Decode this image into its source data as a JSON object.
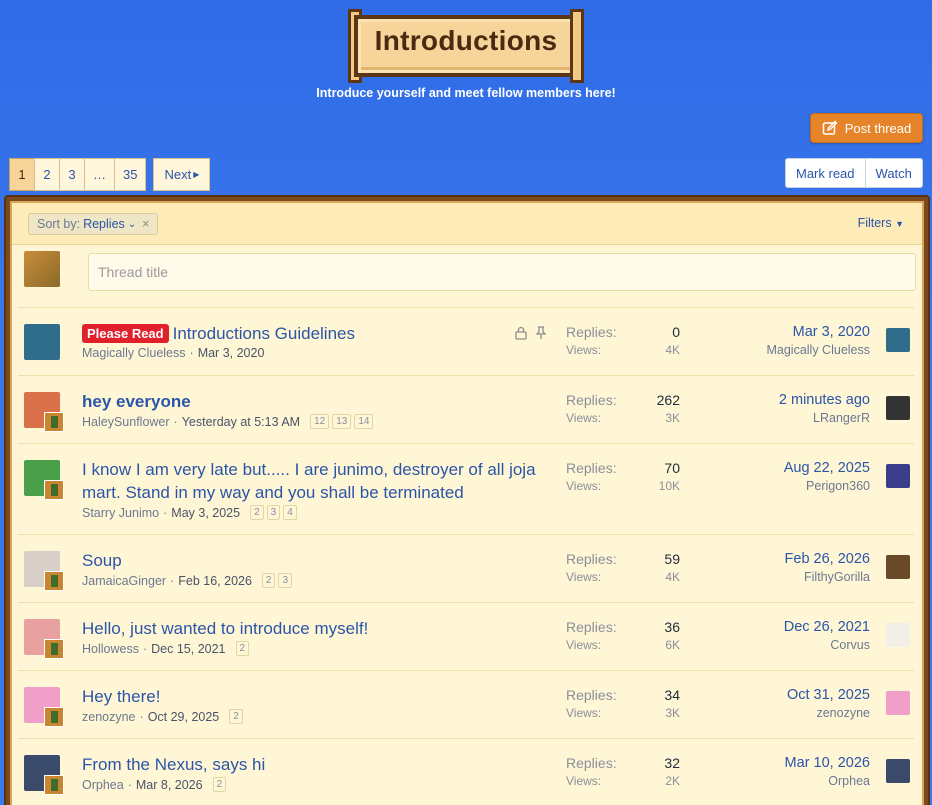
{
  "banner": {
    "title": "Introductions",
    "subtitle": "Introduce yourself and meet fellow members here!"
  },
  "post_thread": {
    "label": "Post thread",
    "icon": "edit-icon"
  },
  "pagination": {
    "pages": [
      "1",
      "2",
      "3",
      "…",
      "35"
    ],
    "current": "1",
    "next_label": "Next"
  },
  "actions": {
    "mark_read": "Mark read",
    "watch": "Watch"
  },
  "filterbar": {
    "sort_label": "Sort by:",
    "sort_value": "Replies",
    "clear": "×",
    "filters_label": "Filters"
  },
  "new_thread": {
    "placeholder": "Thread title"
  },
  "stat_labels": {
    "replies": "Replies:",
    "views": "Views:"
  },
  "threads": [
    {
      "prefix": "Please Read",
      "title": "Introductions Guidelines",
      "author": "Magically Clueless",
      "date": "Mar 3, 2020",
      "pages": [],
      "replies": "0",
      "views": "4K",
      "last_date": "Mar 3, 2020",
      "last_user": "Magically Clueless",
      "locked": true,
      "sticky": true,
      "colors": {
        "avatar": "#2f6d8a",
        "last_avatar": "#2f6d8a"
      }
    },
    {
      "prefix": "",
      "title": "hey everyone",
      "author": "HaleySunflower",
      "date": "Yesterday at 5:13 AM",
      "pages": [
        "12",
        "13",
        "14"
      ],
      "replies": "262",
      "views": "3K",
      "last_date": "2 minutes ago",
      "last_user": "LRangerR",
      "unread": true,
      "colors": {
        "avatar": "#d9704a",
        "last_avatar": "#333333"
      }
    },
    {
      "prefix": "",
      "title": "I know I am very late but..... I are junimo, destroyer of all joja mart. Stand in my way and you shall be terminated",
      "author": "Starry Junimo",
      "date": "May 3, 2025",
      "pages": [
        "2",
        "3",
        "4"
      ],
      "replies": "70",
      "views": "10K",
      "last_date": "Aug 22, 2025",
      "last_user": "Perigon360",
      "colors": {
        "avatar": "#4aa04a",
        "last_avatar": "#3a3e8a"
      }
    },
    {
      "prefix": "",
      "title": "Soup",
      "author": "JamaicaGinger",
      "date": "Feb 16, 2026",
      "pages": [
        "2",
        "3"
      ],
      "replies": "59",
      "views": "4K",
      "last_date": "Feb 26, 2026",
      "last_user": "FilthyGorilla",
      "colors": {
        "avatar": "#d8d0c8",
        "last_avatar": "#6b4a2a"
      }
    },
    {
      "prefix": "",
      "title": "Hello, just wanted to introduce myself!",
      "author": "Hollowess",
      "date": "Dec 15, 2021",
      "pages": [
        "2"
      ],
      "replies": "36",
      "views": "6K",
      "last_date": "Dec 26, 2021",
      "last_user": "Corvus",
      "colors": {
        "avatar": "#e8a0a0",
        "last_avatar": "#f2efe6"
      }
    },
    {
      "prefix": "",
      "title": "Hey there!",
      "author": "zenozyne",
      "date": "Oct 29, 2025",
      "pages": [
        "2"
      ],
      "replies": "34",
      "views": "3K",
      "last_date": "Oct 31, 2025",
      "last_user": "zenozyne",
      "colors": {
        "avatar": "#f0a0c8",
        "last_avatar": "#f0a0c8"
      }
    },
    {
      "prefix": "",
      "title": "From the Nexus, says hi",
      "author": "Orphea",
      "date": "Mar 8, 2026",
      "pages": [
        "2"
      ],
      "replies": "32",
      "views": "2K",
      "last_date": "Mar 10, 2026",
      "last_user": "Orphea",
      "colors": {
        "avatar": "#3a4a6a",
        "last_avatar": "#3a4a6a"
      }
    }
  ]
}
